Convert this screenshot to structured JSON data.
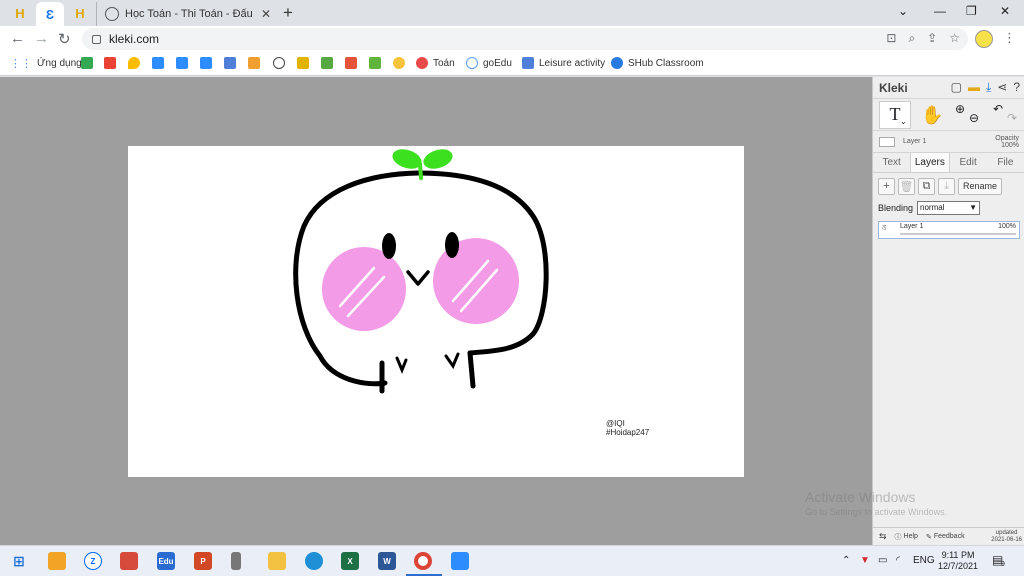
{
  "browser": {
    "active_tab_title": "Học Toán - Thi Toán - Đấu trường",
    "address": "kleki.com",
    "bookmarks": [
      "Ứng dụng",
      "Toán",
      "goEdu",
      "Leisure activity",
      "SHub Classroom"
    ]
  },
  "kleki": {
    "brand": "Kleki",
    "layer_preview_name": "Layer 1",
    "opacity_label": "Opacity",
    "opacity_value": "100%",
    "tabs": [
      "Text",
      "Layers",
      "Edit",
      "File"
    ],
    "rename_label": "Rename",
    "blending_label": "Blending",
    "blending_value": "normal",
    "layer_name": "Layer 1",
    "layer_opacity": "100%",
    "help_label": "Help",
    "feedback_label": "Feedback",
    "updated_label": "updated",
    "updated_date": "2021-06-16"
  },
  "canvas": {
    "watermark_line1": "@IQI",
    "watermark_line2": "#Hoidap247"
  },
  "overlay": {
    "activate_title": "Activate Windows",
    "activate_sub": "Go to Settings to activate Windows."
  },
  "taskbar": {
    "language": "ENG",
    "time": "9:11 PM",
    "date": "12/7/2021",
    "notifications": "9"
  },
  "colors": {
    "sprout": "#3de01f",
    "cheek": "#f39be6",
    "outline": "#000000",
    "workspace": "#9e9e9e"
  }
}
